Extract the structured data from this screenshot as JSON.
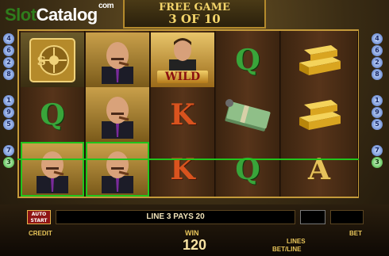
{
  "logo": {
    "part1": "Slot",
    "part2": "Catalog",
    "suffix": "com"
  },
  "free_game": {
    "title": "FREE GAME",
    "count": "3 OF 10"
  },
  "reels": [
    [
      {
        "symbol": "vault"
      },
      {
        "symbol": "blank"
      },
      {
        "symbol": "boss",
        "win": true
      }
    ],
    [
      {
        "symbol": "boss"
      },
      {
        "symbol": "boss"
      },
      {
        "symbol": "boss",
        "win": true
      }
    ],
    [
      {
        "symbol": "wild",
        "label": "WILD"
      },
      {
        "symbol": "K",
        "text": "K"
      },
      {
        "symbol": "K",
        "text": "K"
      }
    ],
    [
      {
        "symbol": "Q",
        "text": "Q"
      },
      {
        "symbol": "money"
      },
      {
        "symbol": "Q",
        "text": "Q"
      }
    ],
    [
      {
        "symbol": "gold"
      },
      {
        "symbol": "gold"
      },
      {
        "symbol": "A",
        "text": "A"
      }
    ]
  ],
  "reel_texts": {
    "q1": "Q",
    "k1": "K",
    "k2": "K",
    "q2": "Q",
    "q3": "Q",
    "a1": "A",
    "wild": "WILD"
  },
  "markers_left": [
    "4",
    "6",
    "2",
    "8",
    "1",
    "9",
    "5",
    "7",
    "3"
  ],
  "markers_right": [
    "4",
    "6",
    "2",
    "8",
    "1",
    "9",
    "5",
    "7",
    "3"
  ],
  "bottom": {
    "auto_start": "AUTO START",
    "message": "LINE 3 PAYS 20",
    "credit_label": "CREDIT",
    "win_label": "WIN",
    "win_value": "120",
    "lines_label": "LINES",
    "bet_line_label": "BET/LINE",
    "bet_label": "BET"
  },
  "colors": {
    "win_frame": "#21c41c",
    "accent": "#e6b34a"
  }
}
